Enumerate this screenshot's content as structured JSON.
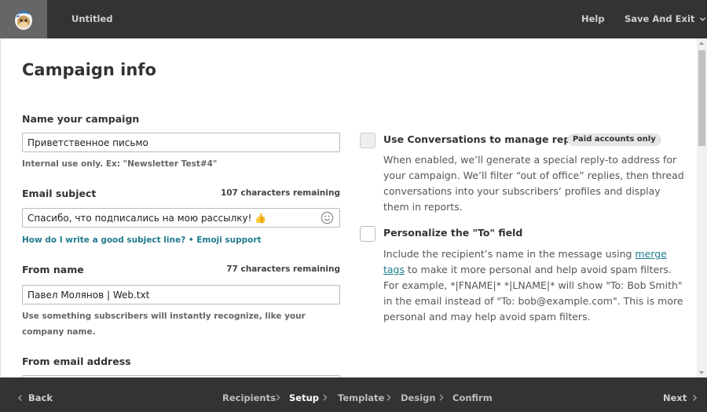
{
  "header": {
    "title": "Untitled",
    "help_label": "Help",
    "save_exit_label": "Save And Exit"
  },
  "page": {
    "title": "Campaign info"
  },
  "fields": {
    "campaign_name": {
      "label": "Name your campaign",
      "value": "Приветственное письмо",
      "hint": "Internal use only. Ex: \"Newsletter Test#4\""
    },
    "subject": {
      "label": "Email subject",
      "remaining": "107 characters remaining",
      "value": "Спасибо, что подписались на мою рассылку! 👍",
      "link_help": "How do I write a good subject line?",
      "link_separator": " • ",
      "link_emoji": "Emoji support"
    },
    "from_name": {
      "label": "From name",
      "remaining": "77 characters remaining",
      "value": "Павел Молянов | Web.txt",
      "hint": "Use something subscribers will instantly recognize, like your company name."
    },
    "from_email": {
      "label": "From email address"
    }
  },
  "options": {
    "conversations": {
      "title": "Use Conversations to manage replies",
      "badge": "Paid accounts only",
      "description": "When enabled, we’ll generate a special reply-to address for your campaign. We’ll filter “out of office” replies, then thread conversations into your subscribers’ profiles and display them in reports."
    },
    "personalize": {
      "title": "Personalize the \"To\" field",
      "desc_before": "Include the recipient’s name in the message using ",
      "desc_link": "merge tags",
      "desc_after": " to make it more personal and help avoid spam filters. For example, *|FNAME|* *|LNAME|* will show \"To: Bob Smith\" in the email instead of \"To: bob@example.com\". This is more personal and may help avoid spam filters."
    }
  },
  "footer": {
    "back_label": "Back",
    "next_label": "Next",
    "steps": [
      "Recipients",
      "Setup",
      "Template",
      "Design",
      "Confirm"
    ],
    "active_step": "Setup"
  },
  "icons": {
    "logo": "mailchimp-freddie-icon",
    "chevron": "chevron-down-icon",
    "emoji": "smiley-icon"
  }
}
